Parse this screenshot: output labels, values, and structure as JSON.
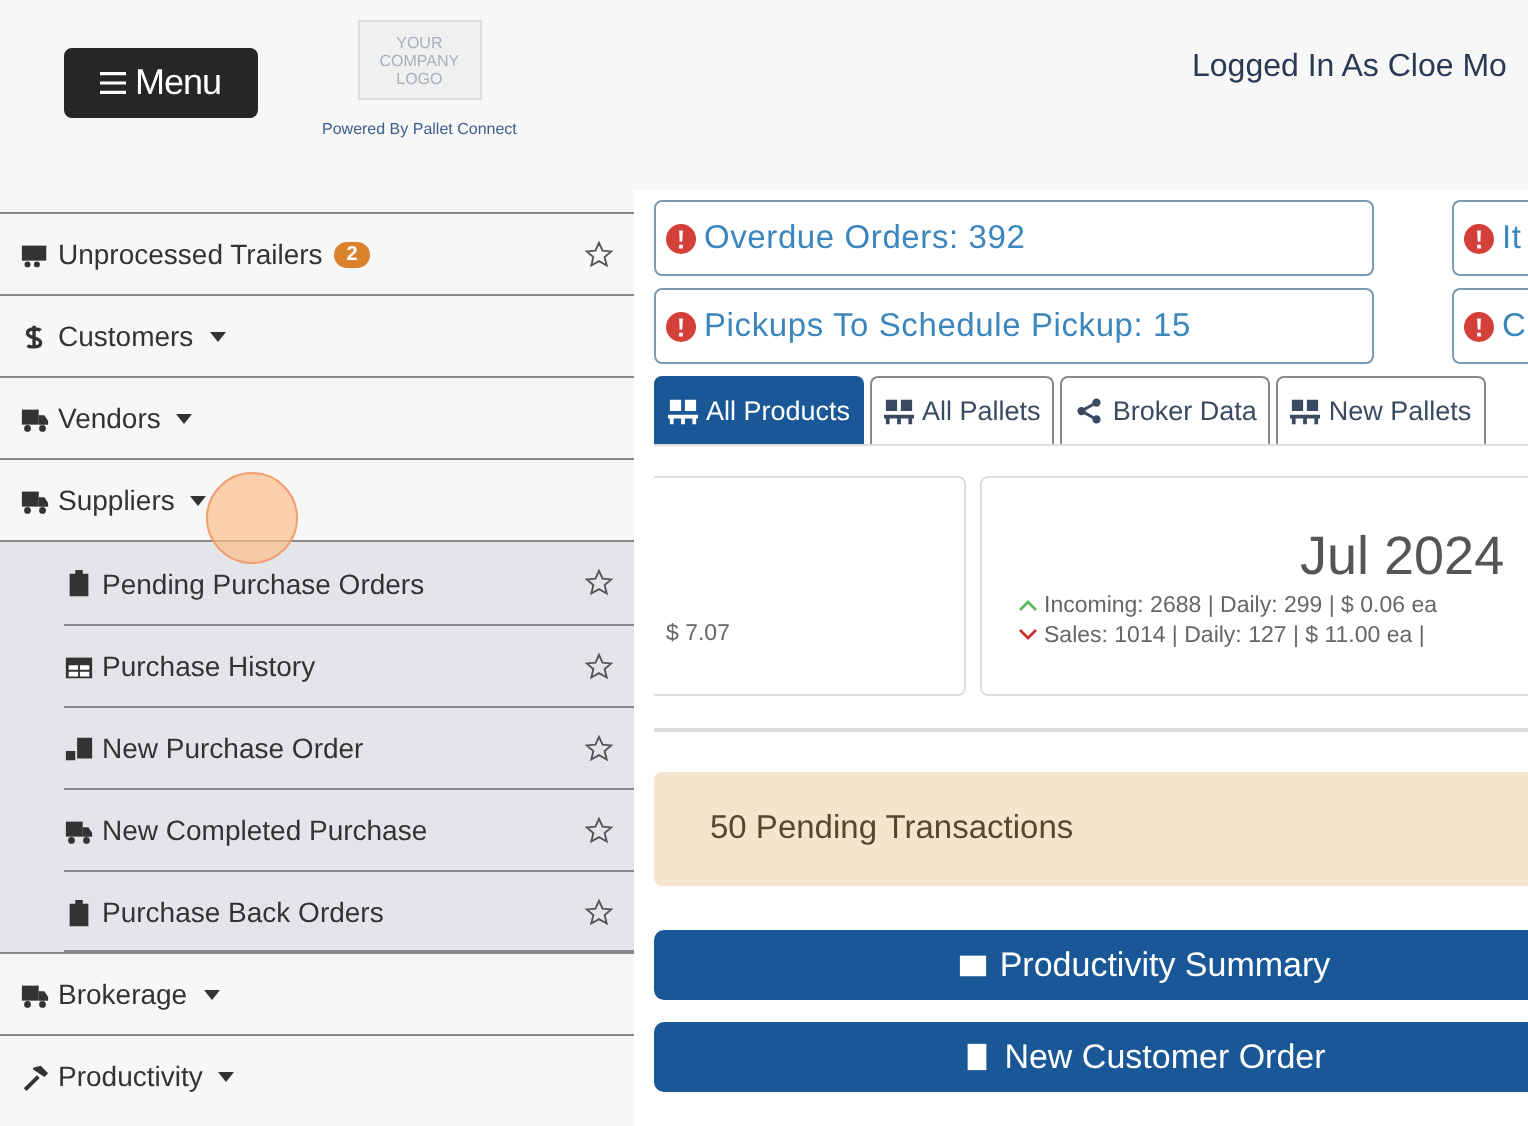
{
  "header": {
    "menu_button": "Menu",
    "logo_lines": [
      "YOUR",
      "COMPANY",
      "LOGO"
    ],
    "powered_by": "Powered By Pallet Connect",
    "user": "Logged In As Cloe Mo"
  },
  "sidebar": {
    "items": [
      {
        "kind": "link",
        "label": "Unprocessed Trailers",
        "badge": "2",
        "starred": false
      },
      {
        "kind": "group",
        "label": "Customers"
      },
      {
        "kind": "group",
        "label": "Vendors"
      },
      {
        "kind": "group",
        "label": "Suppliers",
        "children": [
          {
            "label": "Pending Purchase Orders",
            "starred": false
          },
          {
            "label": "Purchase History",
            "starred": false
          },
          {
            "label": "New Purchase Order",
            "starred": false
          },
          {
            "label": "New Completed Purchase",
            "starred": false
          },
          {
            "label": "Purchase Back Orders",
            "starred": false
          }
        ]
      },
      {
        "kind": "group",
        "label": "Brokerage"
      },
      {
        "kind": "group",
        "label": "Productivity"
      }
    ]
  },
  "alerts": [
    {
      "text": "Overdue Orders: 392"
    },
    {
      "text": "It"
    },
    {
      "text": "Pickups To Schedule Pickup: 15"
    },
    {
      "text": "C"
    }
  ],
  "tabs": [
    {
      "label": "All Products",
      "selected": true
    },
    {
      "label": "All Pallets",
      "selected": false
    },
    {
      "label": "Broker Data",
      "selected": false
    },
    {
      "label": "New Pallets",
      "selected": false
    }
  ],
  "cards": [
    {
      "lines": [
        {
          "kind": "plain",
          "text": "$ 7.07"
        }
      ]
    },
    {
      "title": "Jul 2024",
      "lines": [
        {
          "kind": "up",
          "text": "Incoming: 2688 | Daily: 299 | $ 0.06 ea"
        },
        {
          "kind": "down",
          "text": "Sales: 1014 | Daily: 127 | $ 11.00 ea |"
        }
      ]
    }
  ],
  "pending": "50 Pending Transactions",
  "actions": [
    {
      "label": "Productivity Summary"
    },
    {
      "label": "New Customer Order"
    }
  ]
}
